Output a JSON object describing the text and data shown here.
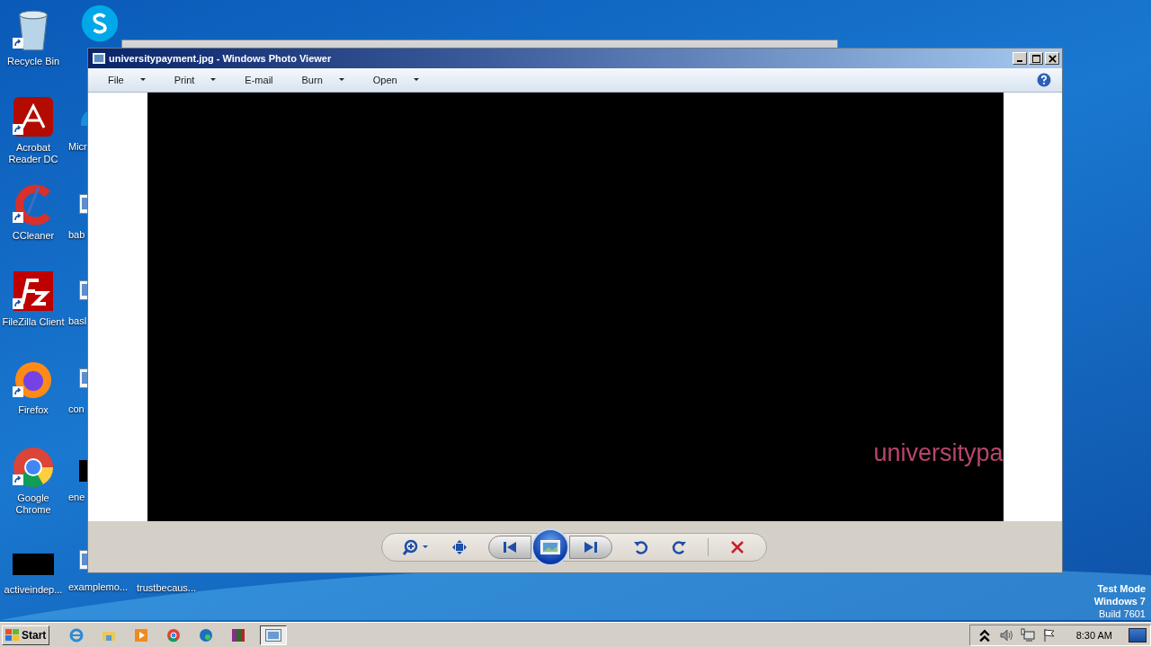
{
  "desktop_icons": [
    {
      "label": "Recycle Bin",
      "kind": "bin"
    },
    {
      "label": "Acrobat\nReader DC",
      "kind": "acrobat"
    },
    {
      "label": "CCleaner",
      "kind": "ccleaner"
    },
    {
      "label": "FileZilla Client",
      "kind": "filezilla"
    },
    {
      "label": "Firefox",
      "kind": "firefox"
    },
    {
      "label": "Google\nChrome",
      "kind": "chrome"
    },
    {
      "label": "activeindep...",
      "kind": "black"
    }
  ],
  "covered_icons": [
    {
      "kind": "skype"
    },
    {
      "label": "Micr",
      "kind": "edge"
    },
    {
      "label": "bab",
      "kind": "doc"
    },
    {
      "label": "basl",
      "kind": "doc"
    },
    {
      "label": "con",
      "kind": "doc"
    },
    {
      "label": "ene",
      "kind": "black"
    },
    {
      "label": "examplemo...",
      "kind": "doc"
    }
  ],
  "bottom_labels": [
    "trustbecaus..."
  ],
  "window": {
    "title": "universitypayment.jpg - Windows Photo Viewer",
    "menu": [
      {
        "label": "File",
        "dropdown": true
      },
      {
        "label": "Print",
        "dropdown": true
      },
      {
        "label": "E-mail",
        "dropdown": false
      },
      {
        "label": "Burn",
        "dropdown": true
      },
      {
        "label": "Open",
        "dropdown": true
      }
    ],
    "image_text": "universitypa"
  },
  "watermark": {
    "lines": [
      "Test Mode",
      "Windows 7",
      "Build 7601"
    ]
  },
  "taskbar": {
    "start": "Start",
    "apps": [
      {
        "kind": "ie",
        "selected": false
      },
      {
        "kind": "explorer",
        "selected": false
      },
      {
        "kind": "media",
        "selected": false
      },
      {
        "kind": "chrome",
        "selected": false
      },
      {
        "kind": "edge",
        "selected": false
      },
      {
        "kind": "winrar",
        "selected": false
      },
      {
        "kind": "photo",
        "selected": true
      }
    ],
    "clock": "8:30 AM"
  }
}
